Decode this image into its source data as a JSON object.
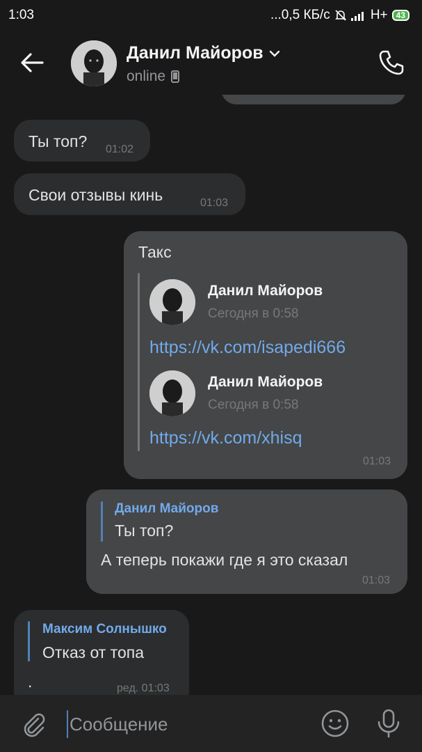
{
  "status_bar": {
    "time": "1:03",
    "network": "...0,5 КБ/с",
    "signal": "H+",
    "battery": "43"
  },
  "header": {
    "name": "Данил Майоров",
    "status": "online",
    "icons": [
      "back-arrow-icon",
      "chevron-down-icon",
      "mobile-icon",
      "phone-icon"
    ]
  },
  "messages": [
    {
      "text": "Ты топ?",
      "time": "01:02"
    },
    {
      "text": "Свои отзывы кинь",
      "time": "01:03"
    },
    {
      "text": "Такс",
      "time": "01:03",
      "forwards": [
        {
          "name": "Данил Майоров",
          "date": "Сегодня в 0:58",
          "link": "https://vk.com/isapedi666"
        },
        {
          "name": "Данил Майоров",
          "date": "Сегодня в 0:58",
          "link": "https://vk.com/xhisq"
        }
      ]
    },
    {
      "reply_name": "Данил Майоров",
      "reply_text": "Ты топ?",
      "text": "А теперь покажи где я это сказал",
      "time": "01:03"
    },
    {
      "reply_name": "Максим Солнышко",
      "reply_text": "Отказ от топа",
      "text": ".",
      "time": "ред. 01:03"
    }
  ],
  "input": {
    "placeholder": "Сообщение",
    "icons": [
      "paperclip-icon",
      "smile-icon",
      "microphone-icon"
    ]
  },
  "colors": {
    "background": "#19191a",
    "incoming_bubble": "#2c2d2e",
    "outgoing_bubble": "#454647",
    "link": "#71aaeb",
    "accent": "#5181b8"
  }
}
